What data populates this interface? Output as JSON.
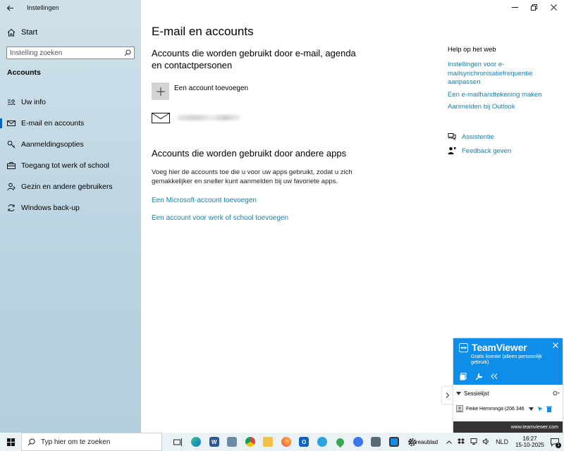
{
  "window": {
    "title": "Instellingen"
  },
  "sidebar": {
    "start_label": "Start",
    "search_placeholder": "Instelling zoeken",
    "section": "Accounts",
    "items": [
      {
        "label": "Uw info",
        "icon": "person-card-icon"
      },
      {
        "label": "E-mail en accounts",
        "icon": "mail-icon",
        "active": true
      },
      {
        "label": "Aanmeldingsopties",
        "icon": "key-icon"
      },
      {
        "label": "Toegang tot werk of school",
        "icon": "briefcase-icon"
      },
      {
        "label": "Gezin en andere gebruikers",
        "icon": "people-icon"
      },
      {
        "label": "Windows back-up",
        "icon": "sync-icon"
      }
    ]
  },
  "main": {
    "title": "E-mail en accounts",
    "section1_title": "Accounts die worden gebruikt door e-mail, agenda en contactpersonen",
    "add_account_label": "Een account toevoegen",
    "section2_title": "Accounts die worden gebruikt door andere apps",
    "section2_desc": "Voeg hier de accounts toe die u voor uw apps gebruikt, zodat u zich gemakkelijker en sneller kunt aanmelden bij uw favoriete apps.",
    "link_microsoft": "Een Microsoft-account toevoegen",
    "link_work": "Een account voor werk of school toevoegen"
  },
  "help": {
    "title": "Help op het web",
    "links": [
      "Instellingen voor e-mailsynchronisatiefrequentie aanpassen",
      "Een e-mailhandtekening maken",
      "Aanmelden bij Outlook"
    ],
    "assist_label": "Assistentie",
    "feedback_label": "Feedback geven"
  },
  "teamviewer": {
    "name": "TeamViewer",
    "license": "Gratis licentie (alleen persoonlijk gebruik)",
    "session_label": "Sessielijst",
    "contact": "Feike Hemminga (206 346",
    "footer": "www.teamviewer.com"
  },
  "taskbar": {
    "search_placeholder": "Typ hier om te zoeken",
    "desktop_label": "Bureaublad",
    "lang": "NLD",
    "time": "16:27",
    "date": "15-10-2025",
    "notif_count": "1",
    "accent": "#0078d4"
  }
}
